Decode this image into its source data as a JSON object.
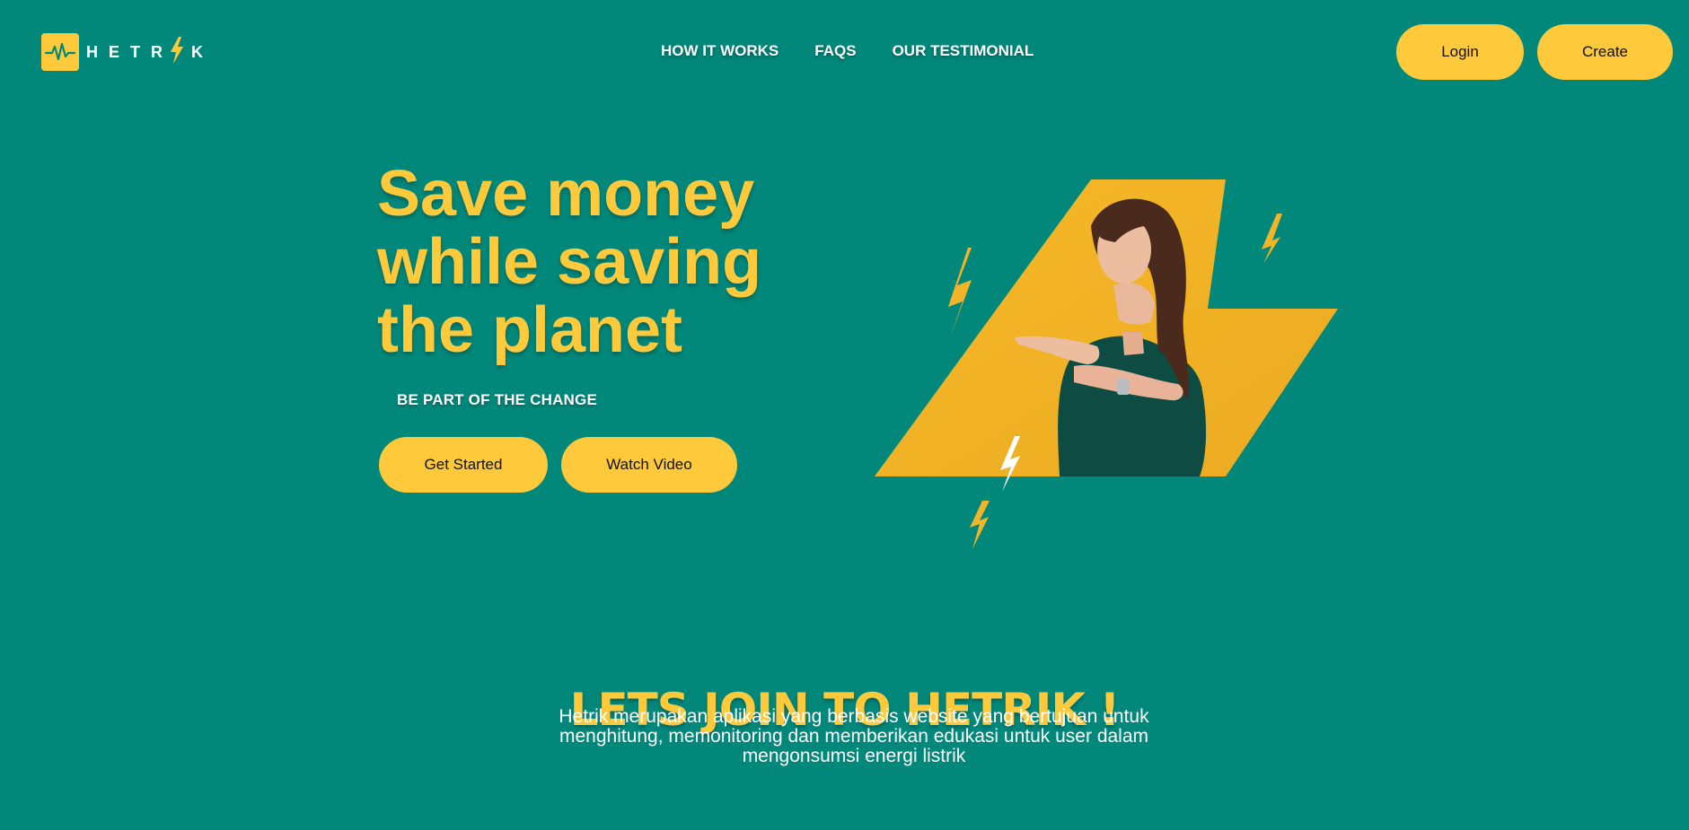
{
  "brand": {
    "name": "HETRIK",
    "letters_before": "HETR",
    "letters_after": "K"
  },
  "nav": {
    "items": [
      {
        "label": "HOW IT WORKS"
      },
      {
        "label": "FAQS"
      },
      {
        "label": "OUR TESTIMONIAL"
      }
    ]
  },
  "header": {
    "login_label": "Login",
    "create_label": "Create"
  },
  "hero": {
    "title": "Save money\nwhile saving\nthe planet",
    "subtitle": "BE PART OF THE CHANGE",
    "get_started_label": "Get Started",
    "watch_video_label": "Watch Video"
  },
  "join": {
    "title": "LETS JOIN TO HETRIK !",
    "description": "Hetrik merupakan aplikasi yang berbasis website yang bertujuan untuk menghitung, memonitoring dan memberikan edukasi untuk user dalam mengonsumsi energi listrik"
  },
  "icons": {
    "logo": "pulse-icon",
    "logo_bolt": "lightning-bolt-icon",
    "hero_decorations": [
      "lightning-bolt-icon"
    ]
  },
  "colors": {
    "background": "#02887b",
    "accent": "#ffc93c",
    "text": "#ffffff"
  }
}
